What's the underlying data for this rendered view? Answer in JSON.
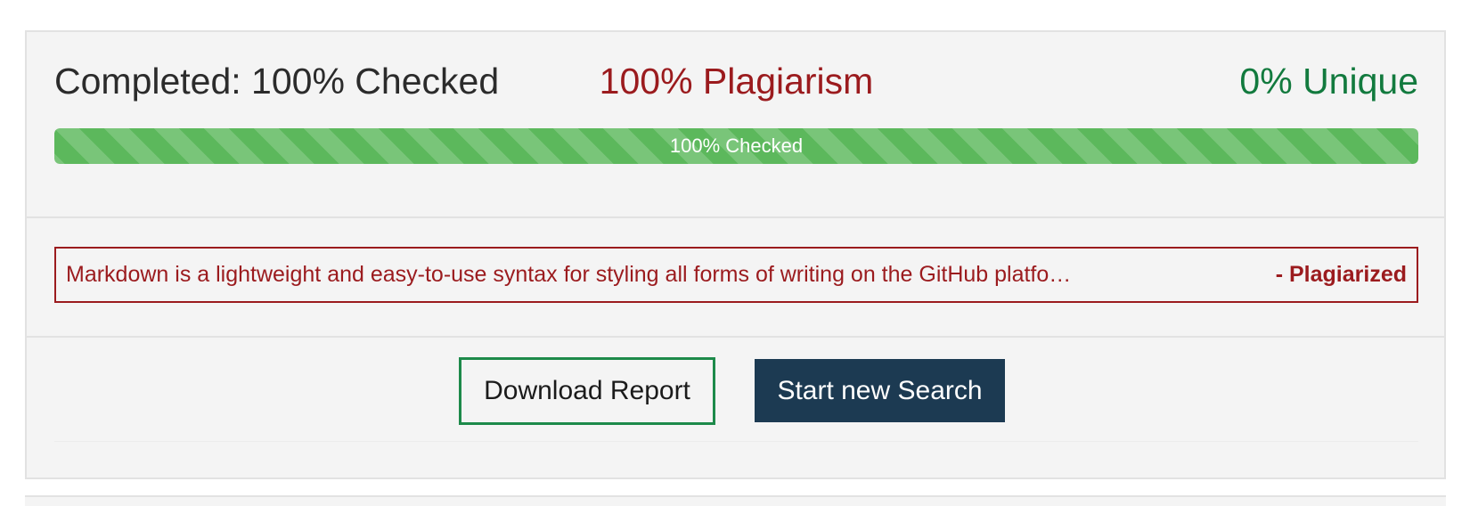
{
  "summary": {
    "completed": "Completed: 100% Checked",
    "plagiarism": "100% Plagiarism",
    "unique": "0% Unique"
  },
  "progress": {
    "label": "100% Checked",
    "percent": 100
  },
  "results": [
    {
      "text": "Markdown is a lightweight and easy-to-use syntax for styling all forms of writing on the GitHub platfo…",
      "status": "- Plagiarized"
    }
  ],
  "actions": {
    "download_label": "Download Report",
    "new_search_label": "Start new Search"
  },
  "colors": {
    "plagiarism": "#9b1b1e",
    "unique": "#127a3e",
    "progress_fill": "#5cb85c",
    "primary_button": "#1c3a52",
    "outline_button_border": "#1d8a4a"
  }
}
